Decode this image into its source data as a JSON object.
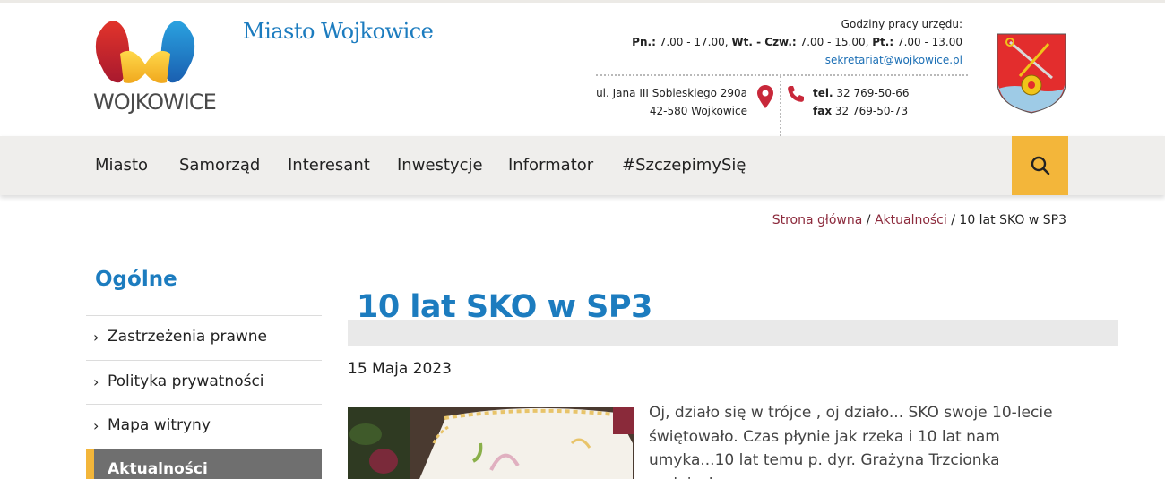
{
  "header": {
    "logo_text": "WOJKOWICE",
    "site_title": "Miasto Wojkowice",
    "hours_title": "Godziny pracy urzędu:",
    "hours": [
      {
        "day": "Pn.:",
        "time": "7.00 - 17.00,"
      },
      {
        "day": "Wt. - Czw.:",
        "time": "7.00 - 15.00,"
      },
      {
        "day": "Pt.:",
        "time": "7.00 - 13.00"
      }
    ],
    "email": "sekretariat@wojkowice.pl",
    "address_line1": "ul. Jana III Sobieskiego 290a",
    "address_line2": "42-580 Wojkowice",
    "tel_label": "tel.",
    "tel": "32 769-50-66",
    "fax_label": "fax",
    "fax": "32 769-50-73"
  },
  "nav": {
    "items": [
      "Miasto",
      "Samorząd",
      "Interesant",
      "Inwestycje",
      "Informator",
      "#SzczepimySię"
    ]
  },
  "breadcrumb": {
    "home": "Strona główna",
    "section": "Aktualności",
    "current": "10 lat SKO w SP3",
    "separator": "/"
  },
  "sidebar": {
    "title": "Ogólne",
    "items": [
      "Zastrzeżenia prawne",
      "Polityka prywatności",
      "Mapa witryny"
    ],
    "active": "Aktualności"
  },
  "article": {
    "title": "10 lat SKO w SP3",
    "date": "15 Maja 2023",
    "text": "Oj, działo się w trójce , oj działo... SKO swoje 10-lecie świętowało. Czas płynie jak rzeka i 10 lat nam umyka...10 lat temu p. dyr. Grażyna Trzcionka podpisała umowę"
  },
  "colors": {
    "accent_blue": "#1c7cbf",
    "accent_yellow": "#f3b63a",
    "link_red": "#8c2a3c",
    "nav_bg": "#efeeec"
  },
  "icons": {
    "search": "search-icon",
    "pin": "map-pin-icon",
    "phone": "phone-icon",
    "chevron": "chevron-right-icon"
  }
}
